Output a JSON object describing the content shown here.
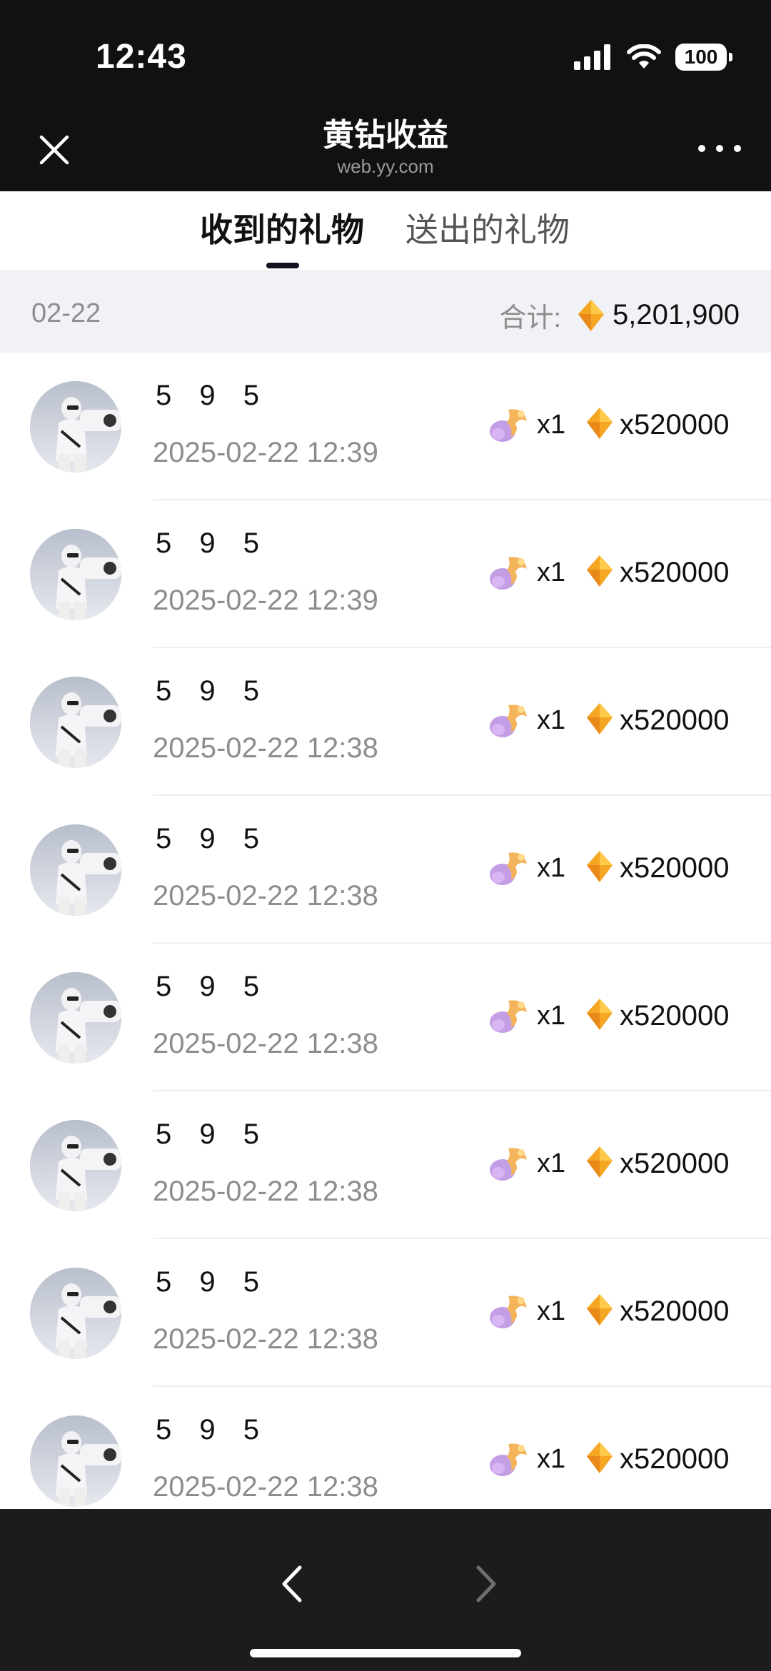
{
  "status": {
    "time": "12:43",
    "battery": "100"
  },
  "nav": {
    "title": "黄钻收益",
    "subtitle": "web.yy.com"
  },
  "tabs": [
    {
      "label": "收到的礼物",
      "active": true
    },
    {
      "label": "送出的礼物",
      "active": false
    }
  ],
  "summary": {
    "date": "02-22",
    "label": "合计:",
    "total": "5,201,900"
  },
  "records": [
    {
      "name": "5 9 5",
      "time": "2025-02-22 12:39",
      "gift_count": "x1",
      "diamonds": "x520000"
    },
    {
      "name": "5 9 5",
      "time": "2025-02-22 12:39",
      "gift_count": "x1",
      "diamonds": "x520000"
    },
    {
      "name": "5 9 5",
      "time": "2025-02-22 12:38",
      "gift_count": "x1",
      "diamonds": "x520000"
    },
    {
      "name": "5 9 5",
      "time": "2025-02-22 12:38",
      "gift_count": "x1",
      "diamonds": "x520000"
    },
    {
      "name": "5 9 5",
      "time": "2025-02-22 12:38",
      "gift_count": "x1",
      "diamonds": "x520000"
    },
    {
      "name": "5 9 5",
      "time": "2025-02-22 12:38",
      "gift_count": "x1",
      "diamonds": "x520000"
    },
    {
      "name": "5 9 5",
      "time": "2025-02-22 12:38",
      "gift_count": "x1",
      "diamonds": "x520000"
    },
    {
      "name": "5 9 5",
      "time": "2025-02-22 12:38",
      "gift_count": "x1",
      "diamonds": "x520000"
    }
  ],
  "colors": {
    "header_bg": "#111111",
    "summary_bg": "#f1f2f5",
    "diamond": "#f5a623",
    "bottom_bar": "#1c1c1e"
  },
  "icons": {
    "close": "close-icon",
    "more": "more-dots-icon",
    "diamond": "diamond-icon",
    "gift": "gift-icon",
    "back": "chevron-left-icon",
    "forward": "chevron-right-icon"
  }
}
